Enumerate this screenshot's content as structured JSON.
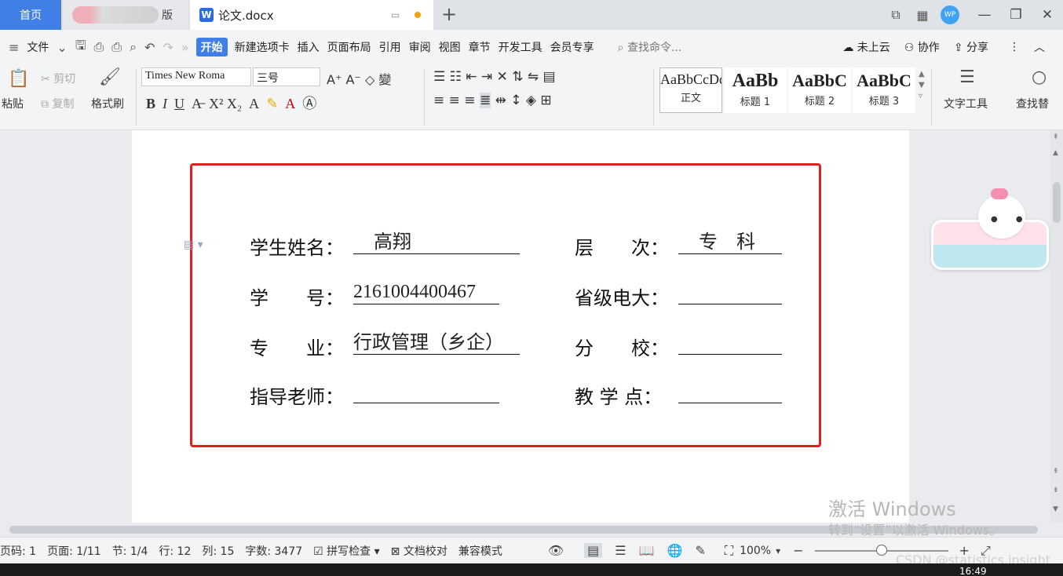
{
  "tabs": {
    "home": "首页",
    "blurred_suffix": "版",
    "doc_title": "论文.docx"
  },
  "menu": {
    "file": "文件",
    "items": [
      "开始",
      "新建选项卡",
      "插入",
      "页面布局",
      "引用",
      "审阅",
      "视图",
      "章节",
      "开发工具",
      "会员专享"
    ],
    "search_placeholder": "查找命令...",
    "cloud": "未上云",
    "collab": "协作",
    "share": "分享"
  },
  "ribbon": {
    "paste": "粘贴",
    "cut": "剪切",
    "copy": "复制",
    "format_painter": "格式刷",
    "font_name": "Times New Roma",
    "font_size": "三号",
    "styles": [
      {
        "sample": "AaBbCcDd",
        "name": "正文"
      },
      {
        "sample": "AaBb",
        "name": "标题 1"
      },
      {
        "sample": "AaBbC",
        "name": "标题 2"
      },
      {
        "sample": "AaBbC",
        "name": "标题 3"
      }
    ],
    "text_tools": "文字工具",
    "find_replace": "查找替"
  },
  "form": {
    "student_name_label": "学生姓名：",
    "student_name": "高翔",
    "level_label": "层　　次：",
    "level": "专　科",
    "student_id_label": "学　　号：",
    "student_id": "2161004400467",
    "provincial_label": "省级电大：",
    "provincial": "",
    "major_label": "专　　业：",
    "major": "行政管理（乡企）",
    "branch_label": "分　　校：",
    "branch": "",
    "advisor_label": "指导老师：",
    "advisor": "",
    "teaching_point_label": "教 学 点：",
    "teaching_point": ""
  },
  "watermark": {
    "line1": "激活 Windows",
    "line2": "转到“设置”以激活 Windows。"
  },
  "status": {
    "page_num": "页码: 1",
    "page": "页面: 1/11",
    "section": "节: 1/4",
    "row": "行: 12",
    "col": "列: 15",
    "word_count": "字数: 3477",
    "spell_check": "拼写检查",
    "doc_proof": "文档校对",
    "compat": "兼容模式",
    "zoom": "100%",
    "zoom_fraction": 0.5
  },
  "footer": {
    "csdn": "CSDN @statistics.insight",
    "time": "16:49"
  }
}
